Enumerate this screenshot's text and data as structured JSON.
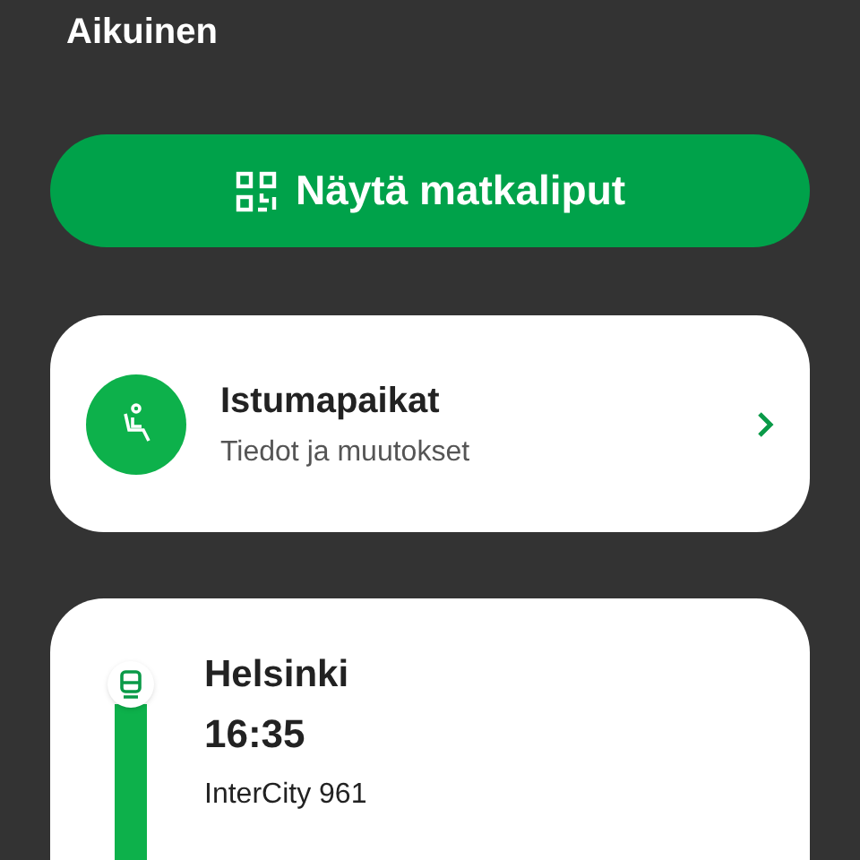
{
  "passenger": "Aikuinen",
  "tickets_button": {
    "label": "Näytä matkaliput"
  },
  "seats": {
    "title": "Istumapaikat",
    "subtitle": "Tiedot ja muutokset"
  },
  "journey": {
    "station": "Helsinki",
    "time": "16:35",
    "train": "InterCity 961"
  }
}
